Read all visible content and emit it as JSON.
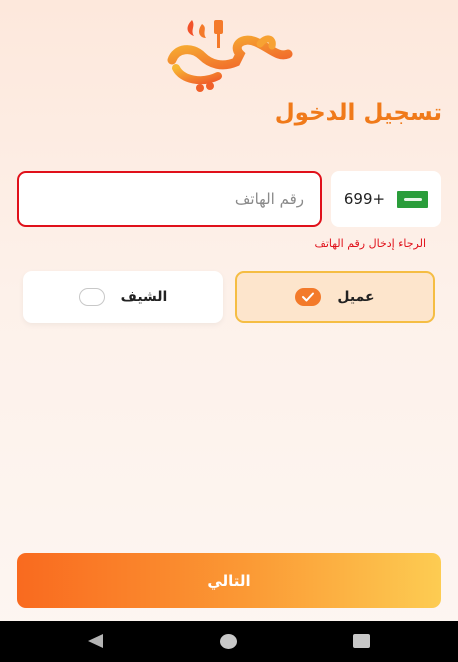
{
  "app": {
    "logo_text": "طاقي",
    "title": "تسجيل الدخول"
  },
  "phone": {
    "country_code": "699+",
    "flag_icon": "saudi-flag-icon",
    "placeholder": "رقم الهاتف",
    "value": "",
    "error": "الرجاء إدخال رقم الهاتف"
  },
  "roles": [
    {
      "label": "عميل",
      "selected": true
    },
    {
      "label": "الشيف",
      "selected": false
    }
  ],
  "actions": {
    "next_label": "التالي"
  },
  "colors": {
    "accent": "#f07a1a",
    "error": "#e0101a",
    "selected_border": "#f5bd43",
    "selected_bg": "#fde5cc"
  }
}
